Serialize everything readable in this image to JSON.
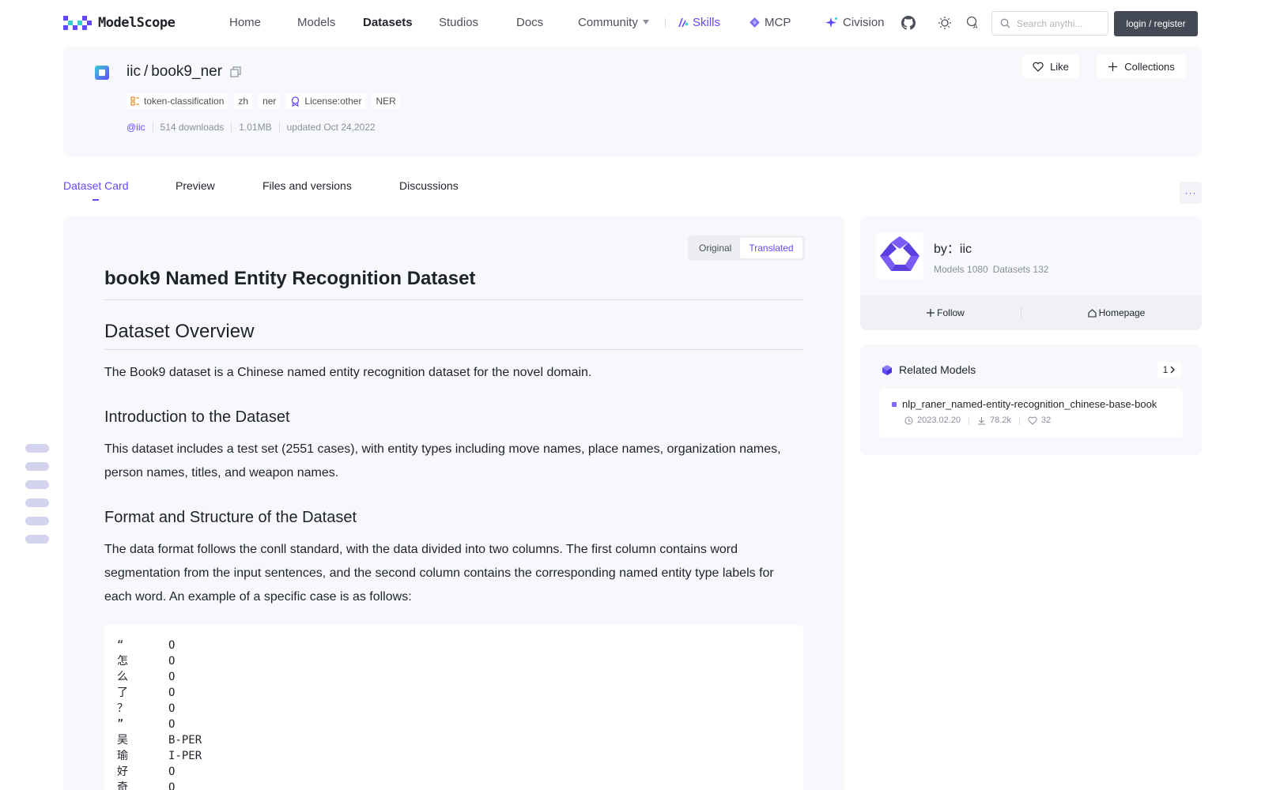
{
  "nav": {
    "logo_text": "ModelScope",
    "items": {
      "home": "Home",
      "models": "Models",
      "datasets": "Datasets",
      "studios": "Studios",
      "docs": "Docs",
      "community": "Community",
      "skills": "Skills",
      "mcp": "MCP",
      "civision": "Civision"
    },
    "search_placeholder": "Search anythi...",
    "login_label": "login / register"
  },
  "dataset": {
    "owner": "iic",
    "separator": "/",
    "name": "book9_ner",
    "tags": {
      "task": "token-classification",
      "lang": "zh",
      "type": "ner",
      "license": "License:other",
      "extra": "NER"
    },
    "meta": {
      "owner_handle": "@iic",
      "downloads": "514 downloads",
      "size": "1.01MB",
      "updated": "updated Oct 24,2022"
    },
    "like_label": "Like",
    "collections_label": "Collections"
  },
  "tabs": {
    "card": "Dataset Card",
    "preview": "Preview",
    "files": "Files and versions",
    "discussions": "Discussions",
    "more": "···"
  },
  "doc": {
    "toggle_original": "Original",
    "toggle_translated": "Translated",
    "title": "book9 Named Entity Recognition Dataset",
    "h_overview": "Dataset Overview",
    "p_overview": "The Book9 dataset is a Chinese named entity recognition dataset for the novel domain.",
    "h_intro": "Introduction to the Dataset",
    "p_intro": "This dataset includes a test set (2551 cases), with entity types including move names, place names, organization names, person names, titles, and weapon names.",
    "h_format": "Format and Structure of the Dataset",
    "p_format": "The data format follows the conll standard, with the data divided into two columns. The first column contains word segmentation from the input sentences, and the second column contains the corresponding named entity type labels for each word. An example of a specific case is as follows:",
    "code_rows": [
      [
        "“",
        "O"
      ],
      [
        "怎",
        "O"
      ],
      [
        "么",
        "O"
      ],
      [
        "了",
        "O"
      ],
      [
        "？",
        "O"
      ],
      [
        "”",
        "O"
      ],
      [
        "吴",
        "B-PER"
      ],
      [
        "瑜",
        "I-PER"
      ],
      [
        "好",
        "O"
      ],
      [
        "奇",
        "O"
      ]
    ]
  },
  "author": {
    "name": "by：iic",
    "models": "Models 1080",
    "datasets": "Datasets 132",
    "follow_label": "Follow",
    "homepage_label": "Homepage"
  },
  "related": {
    "title": "Related Models",
    "count": "1",
    "item": {
      "name": "nlp_raner_named-entity-recognition_chinese-base-book",
      "date": "2023.02.20",
      "downloads": "78.2k",
      "likes": "32"
    }
  },
  "colors": {
    "accent": "#624aff",
    "accent_secondary": "#36cfd1",
    "card_bg": "#f7f8fb"
  }
}
